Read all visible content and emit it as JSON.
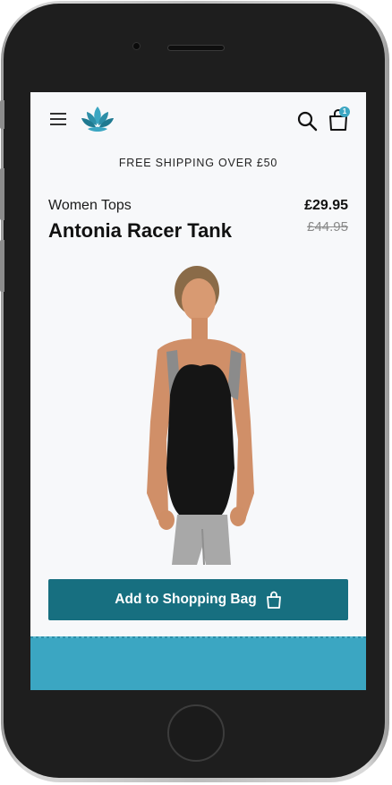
{
  "header": {
    "menu_icon": "hamburger-menu-icon",
    "logo_icon": "lotus-logo-icon",
    "search_icon": "search-icon",
    "cart_icon": "shopping-bag-icon",
    "cart_count": "1"
  },
  "promo": {
    "text": "FREE SHIPPING OVER £50"
  },
  "product": {
    "category": "Women Tops",
    "title": "Antonia Racer Tank",
    "price": "£29.95",
    "old_price": "£44.95"
  },
  "cta": {
    "label": "Add to Shopping Bag",
    "icon": "shopping-bag-icon"
  },
  "colors": {
    "accent": "#176f80",
    "brand": "#3ba6c2",
    "background": "#f7f8fa"
  }
}
